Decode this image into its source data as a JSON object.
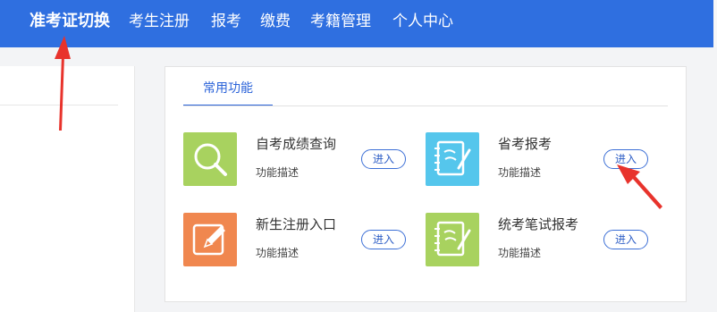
{
  "nav": {
    "items": [
      {
        "label": "准考证切换",
        "active": true
      },
      {
        "label": "考生注册"
      },
      {
        "label": "报考"
      },
      {
        "label": "缴费"
      },
      {
        "label": "考籍管理"
      },
      {
        "label": "个人中心"
      }
    ]
  },
  "functions": {
    "tab_label": "常用功能",
    "items": [
      {
        "title": "自考成绩查询",
        "desc": "功能描述",
        "button": "进入",
        "icon": "search-icon",
        "color": "#a8d25f"
      },
      {
        "title": "省考报考",
        "desc": "功能描述",
        "button": "进入",
        "icon": "notebook-icon",
        "color": "#55c6ec"
      },
      {
        "title": "新生注册入口",
        "desc": "功能描述",
        "button": "进入",
        "icon": "edit-icon",
        "color": "#f0874f"
      },
      {
        "title": "统考笔试报考",
        "desc": "功能描述",
        "button": "进入",
        "icon": "notebook-icon",
        "color": "#a8d25f"
      }
    ]
  },
  "colors": {
    "topbar": "#2f6fe0",
    "accent": "#2b63d9",
    "annotation_arrow": "#e8332c"
  }
}
